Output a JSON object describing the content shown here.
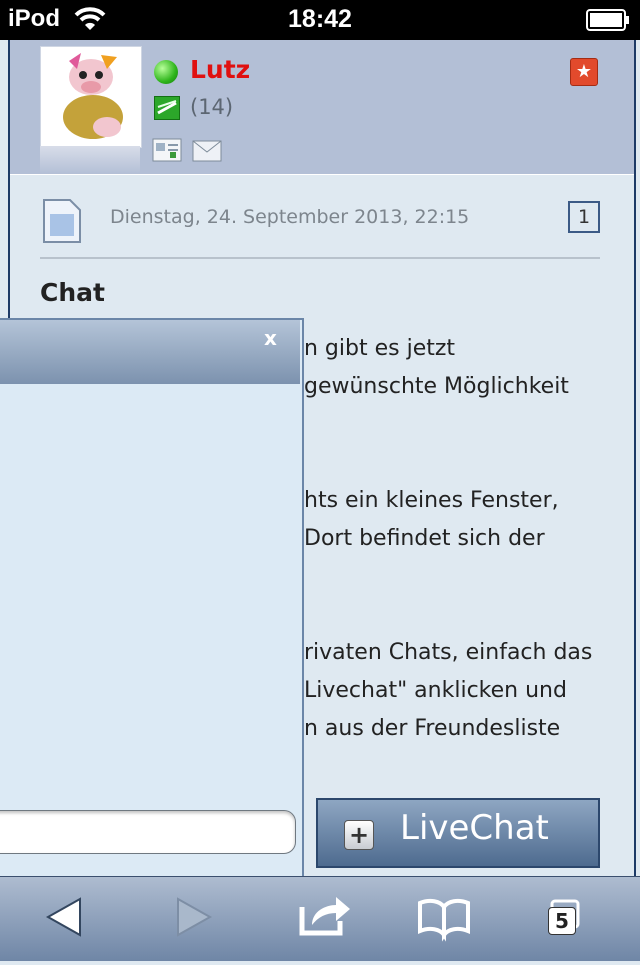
{
  "status_bar": {
    "carrier": "iPod",
    "time": "18:42"
  },
  "profile": {
    "username": "Lutz",
    "post_count": "(14)",
    "online_status_color": "#2fb51c",
    "username_color": "#e01010"
  },
  "post": {
    "date": "Dienstag, 24. September 2013, 22:15",
    "number": "1",
    "title": "Chat",
    "lines": [
      "n gibt es jetzt",
      "gewünschte Möglichkeit",
      "hts ein kleines Fenster,",
      "Dort befindet sich der",
      "rivaten Chats, einfach das",
      "Livechat\" anklicken und",
      "n aus der Freundesliste"
    ]
  },
  "chat_window": {
    "close_label": "x",
    "input_value": ""
  },
  "livechat": {
    "label": "LiveChat",
    "plus": "+"
  },
  "toolbar": {
    "tabs_count": "5"
  },
  "icons": [
    "wifi-icon",
    "battery-icon",
    "avatar",
    "online-icon",
    "rank-icon",
    "profile-card-icon",
    "mail-icon",
    "star-icon",
    "post-icon",
    "back-arrow-icon",
    "forward-arrow-icon",
    "share-icon",
    "bookmarks-icon",
    "tabs-icon"
  ]
}
